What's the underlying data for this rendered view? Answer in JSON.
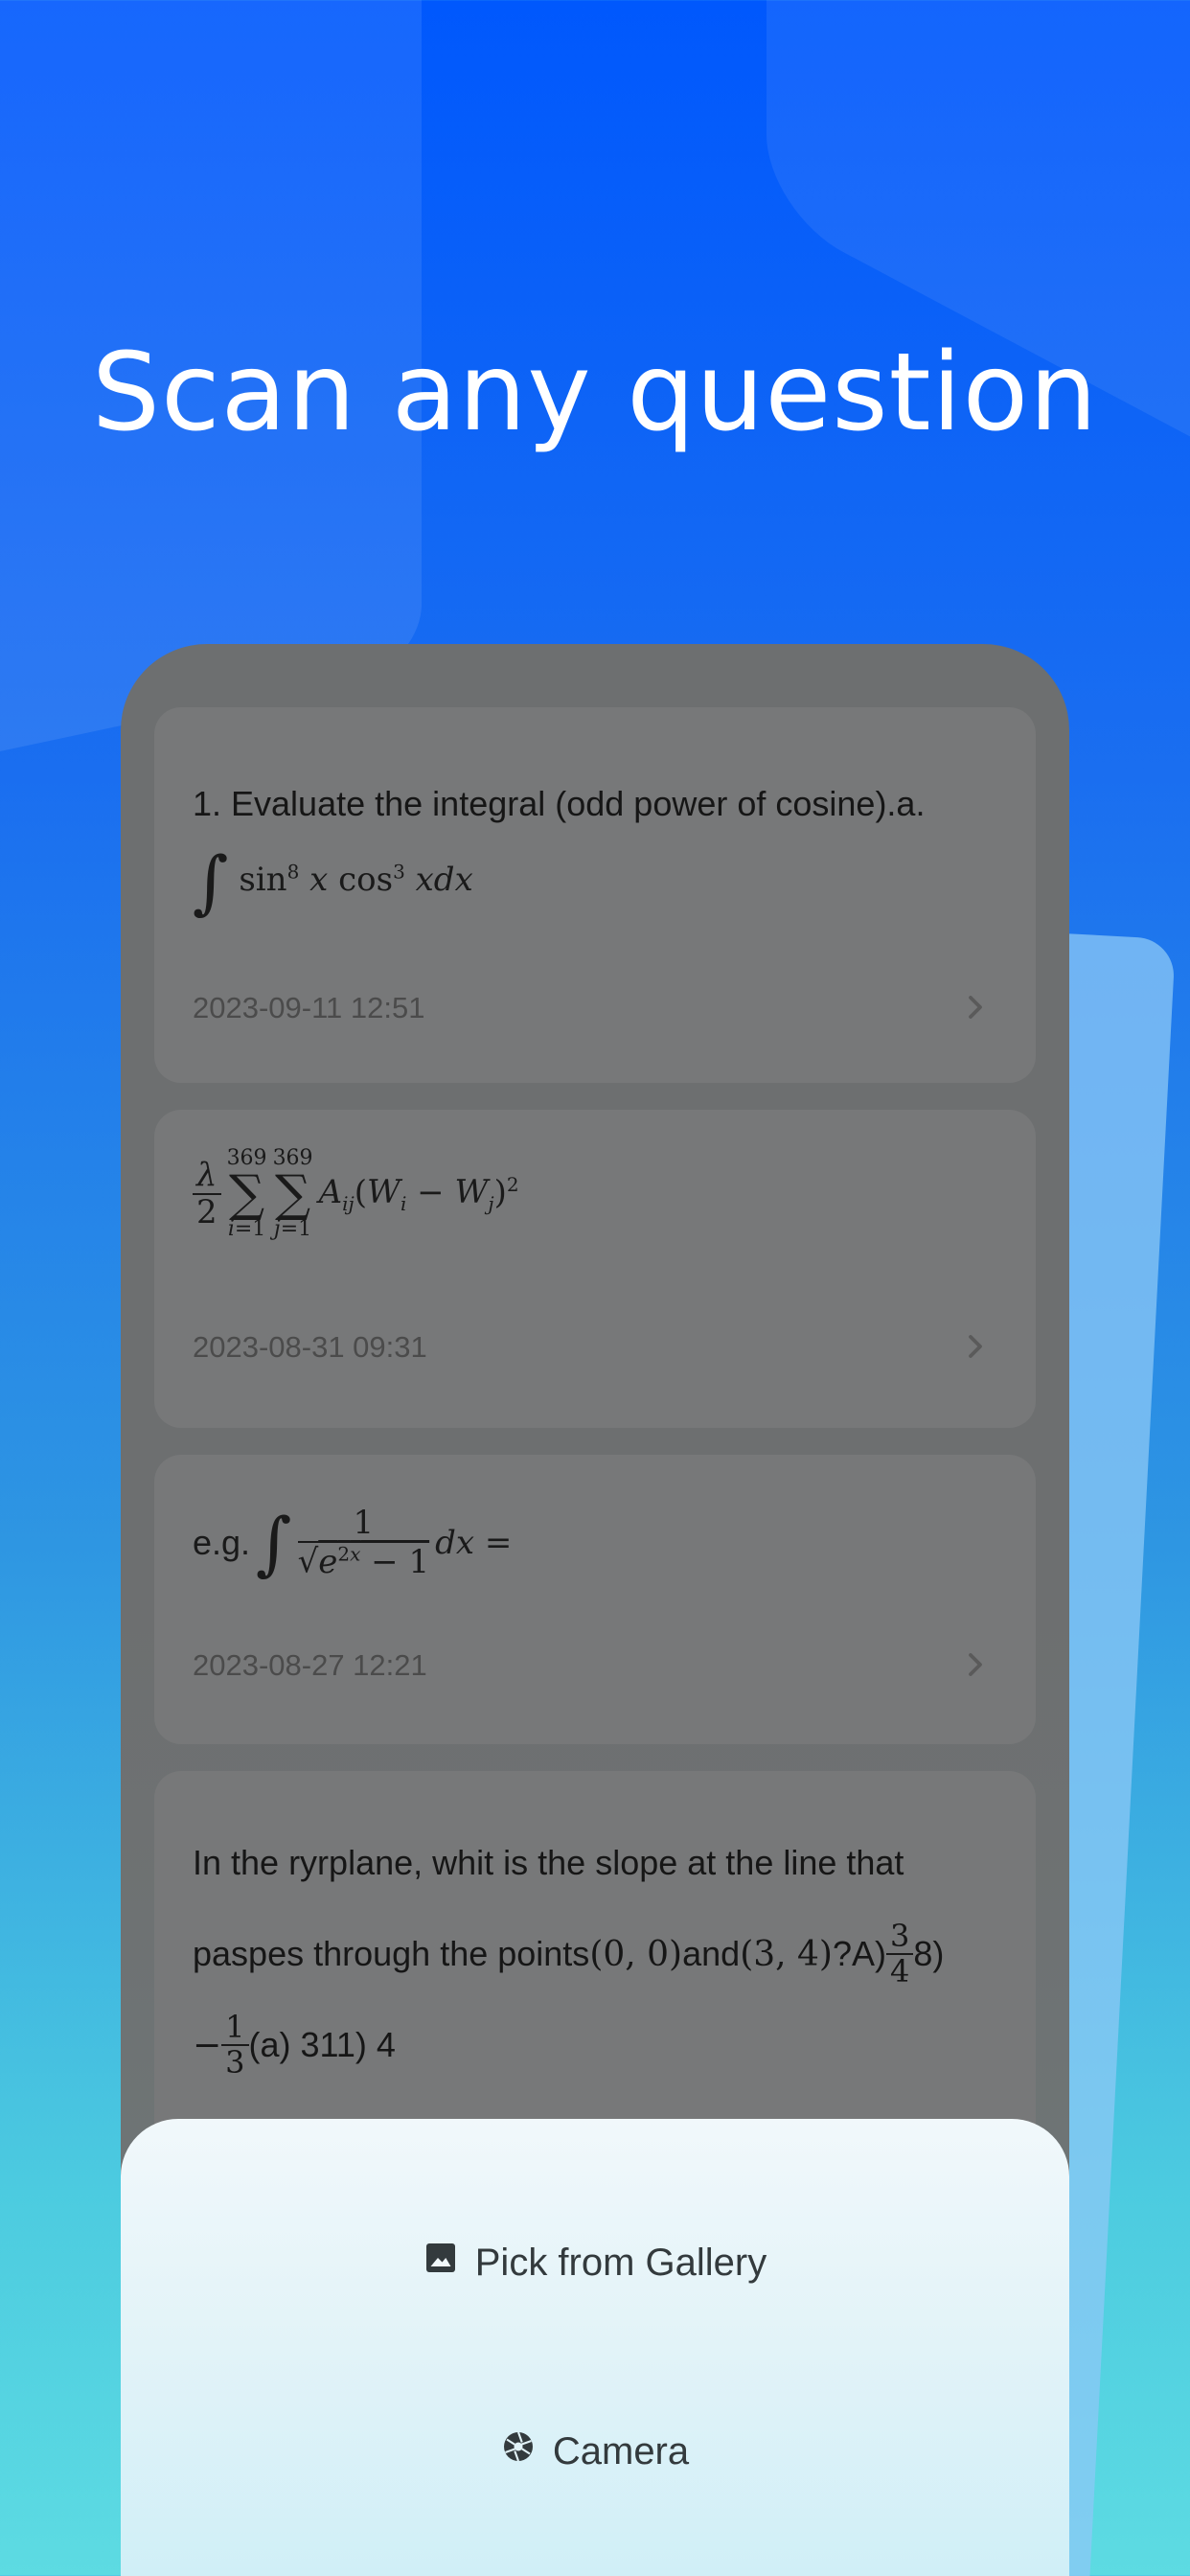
{
  "headline": "Scan any question",
  "history": [
    {
      "text_line1": "1. Evaluate the integral (odd power of cosine).a.",
      "math": "∫ sin⁸ x cos³ x dx",
      "date": "2023-09-11 12:51"
    },
    {
      "math": "λ/2 Σ(i=1..369) Σ(j=1..369) Aij(Wi − Wj)²",
      "date": "2023-08-31 09:31"
    },
    {
      "prefix": "e.g.",
      "math": "∫ 1/√(e^2x − 1) dx =",
      "date": "2023-08-27 12:21"
    },
    {
      "text_line1": "In the ryrplane, whit is the slope at the line that",
      "text_line2a": "paspes through the points",
      "text_line2b": "and",
      "text_line2c": "?A)",
      "text_line2d": "8)",
      "text_line3": "(a) 311) 4"
    }
  ],
  "sheet": {
    "gallery_label": "Pick from Gallery",
    "camera_label": "Camera"
  },
  "colors": {
    "bg_top": "#0058fd",
    "bg_bottom": "#5ddbe2",
    "overlay": "#6d6f70",
    "card": "#777879",
    "sheet": "#e2f3f8"
  },
  "icons": {
    "gallery": "image-icon",
    "camera": "camera-aperture-icon",
    "chevron": "chevron-right-icon"
  }
}
